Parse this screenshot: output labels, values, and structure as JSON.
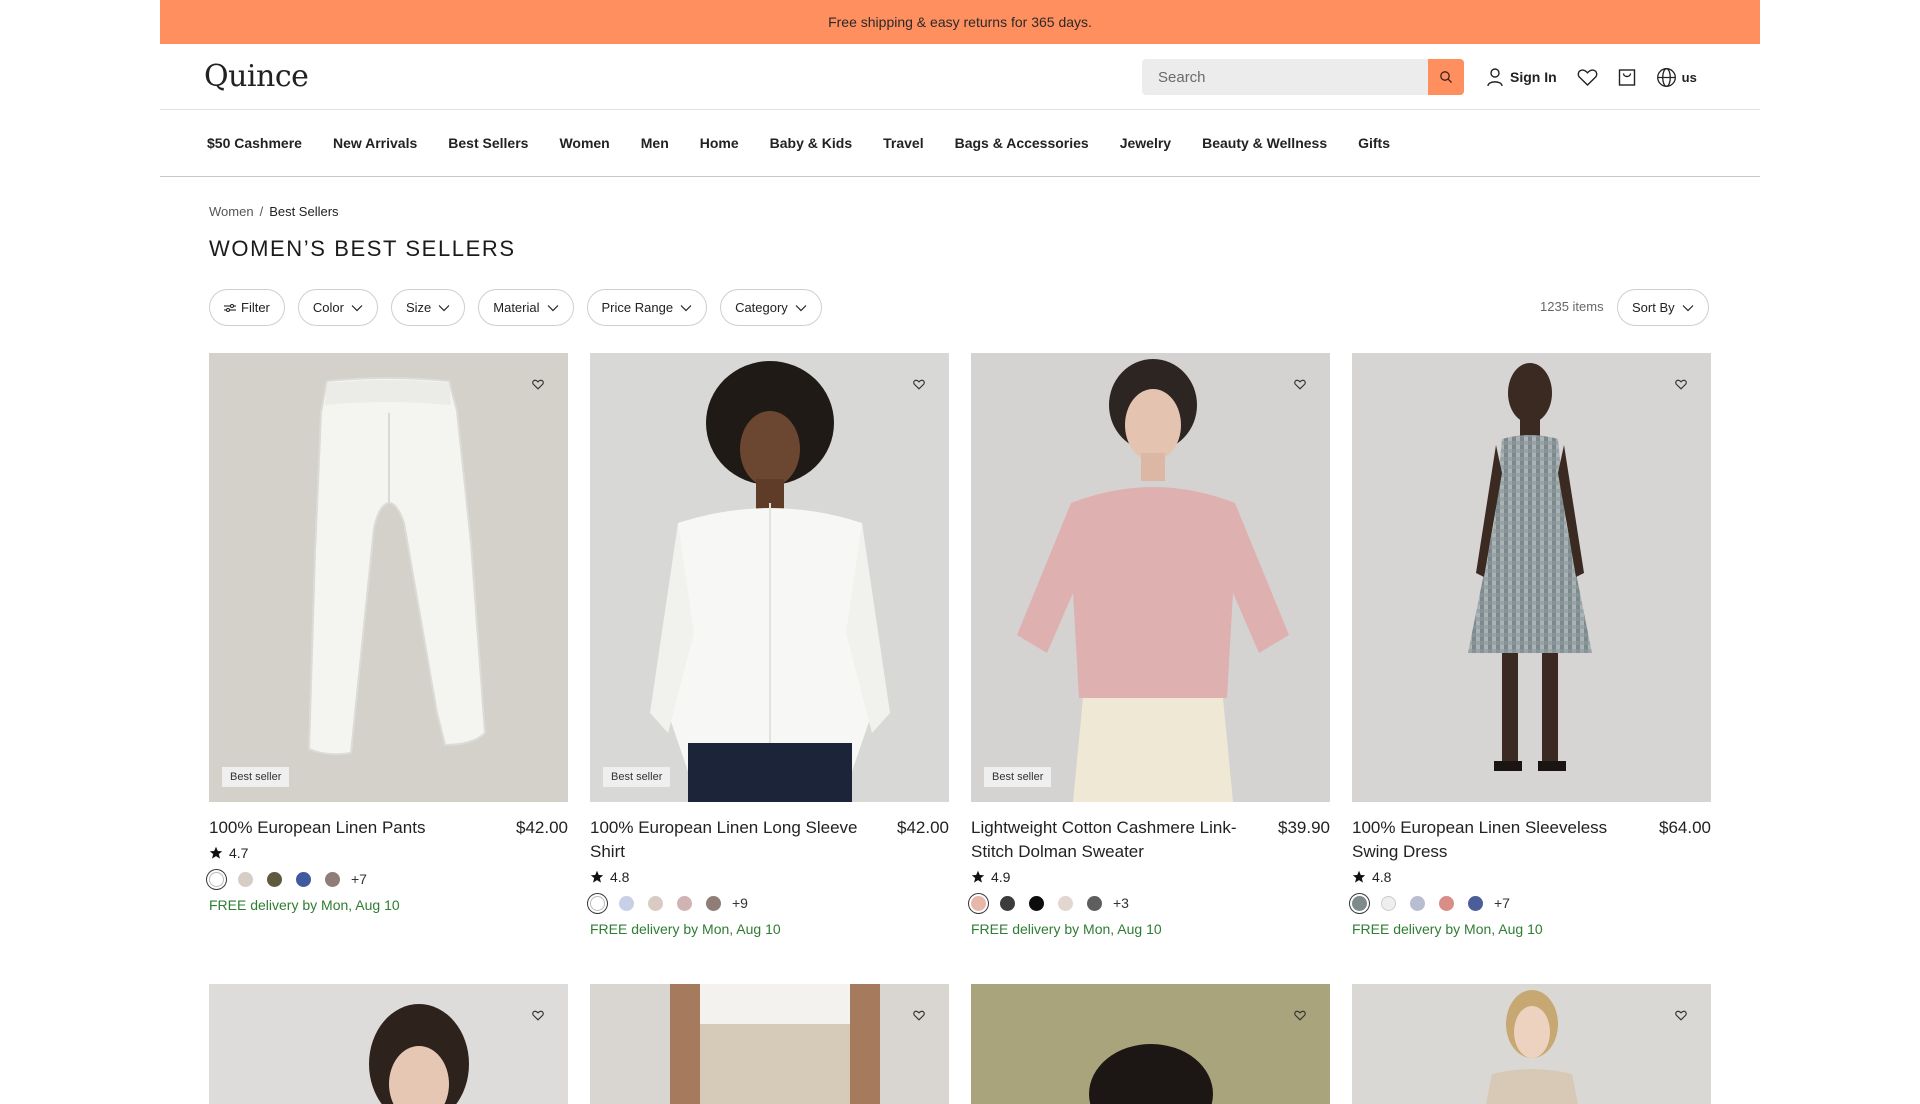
{
  "promo": {
    "text": "Free shipping & easy returns for 365 days."
  },
  "header": {
    "logo": "Quince",
    "search_placeholder": "Search",
    "sign_in": "Sign In",
    "locale": "us"
  },
  "nav": [
    "$50 Cashmere",
    "New Arrivals",
    "Best Sellers",
    "Women",
    "Men",
    "Home",
    "Baby & Kids",
    "Travel",
    "Bags & Accessories",
    "Jewelry",
    "Beauty & Wellness",
    "Gifts"
  ],
  "breadcrumb": {
    "parent": "Women",
    "separator": "/",
    "current": "Best Sellers"
  },
  "page_title": "WOMEN’S BEST SELLERS",
  "filters": {
    "filter": "Filter",
    "color": "Color",
    "size": "Size",
    "material": "Material",
    "price": "Price Range",
    "category": "Category"
  },
  "item_count": "1235 items",
  "sort_label": "Sort By",
  "colors": {
    "accent": "#ff8f5e",
    "delivery": "#2f7d32"
  },
  "products": [
    {
      "name": "100% European Linen Pants",
      "price": "$42.00",
      "rating": "4.7",
      "badge": "Best seller",
      "swatches": [
        "#ffffff",
        "#d6cec4",
        "#5f5a3f",
        "#3f5a9e",
        "#8e7e77"
      ],
      "more": "+7",
      "delivery": "FREE delivery by Mon, Aug 10"
    },
    {
      "name": "100% European Linen Long Sleeve Shirt",
      "price": "$42.00",
      "rating": "4.8",
      "badge": "Best seller",
      "swatches": [
        "#ffffff",
        "#c7d0e6",
        "#d8cbc4",
        "#d2b3b3",
        "#8e7e77"
      ],
      "more": "+9",
      "delivery": "FREE delivery by Mon, Aug 10"
    },
    {
      "name": "Lightweight Cotton Cashmere Link-Stitch Dolman Sweater",
      "price": "$39.90",
      "rating": "4.9",
      "badge": "Best seller",
      "swatches": [
        "#e7b8a9",
        "#3c3c3c",
        "#0c0c0c",
        "#e3d5cf",
        "#5e5e5e"
      ],
      "more": "+3",
      "delivery": "FREE delivery by Mon, Aug 10"
    },
    {
      "name": "100% European Linen Sleeveless Swing Dress",
      "price": "$64.00",
      "rating": "4.8",
      "badge": "",
      "swatches": [
        "#7f8a8a",
        "#eeeeee",
        "#b8bed0",
        "#d98d87",
        "#4a5e99"
      ],
      "more": "+7",
      "delivery": "FREE delivery by Mon, Aug 10"
    }
  ]
}
